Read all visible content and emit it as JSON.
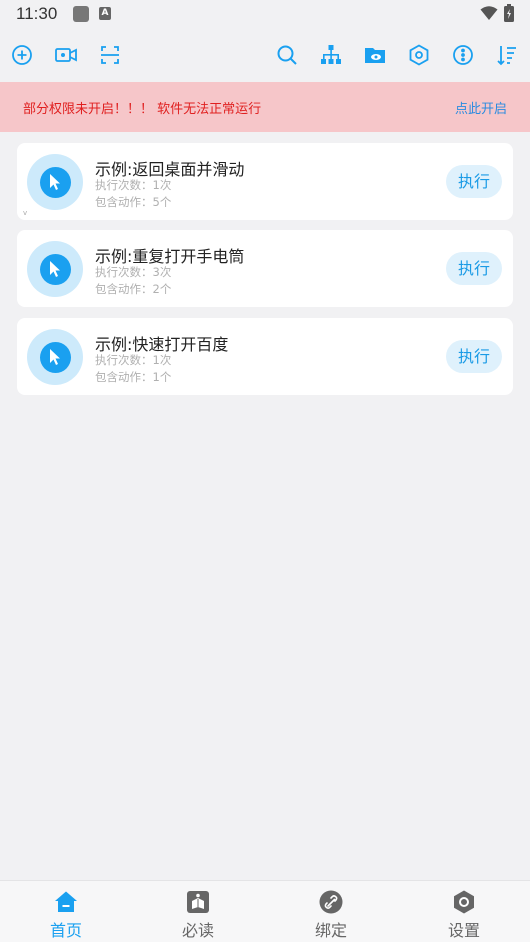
{
  "status_bar": {
    "time": "11:30"
  },
  "toolbar": {
    "left_icons": [
      "add-circle-icon",
      "video-record-icon",
      "scan-icon"
    ],
    "right_icons": [
      "search-icon",
      "hierarchy-icon",
      "folder-eye-icon",
      "hexagon-settings-icon",
      "info-more-icon",
      "sort-icon"
    ],
    "accent_color": "#1aa0f0"
  },
  "warning": {
    "message": "部分权限未开启！！！ 软件无法正常运行",
    "action_label": "点此开启",
    "text_color": "#e02020",
    "background_color": "#f6c6c9"
  },
  "tasks": [
    {
      "title": "示例:返回桌面并滑动",
      "exec_count": "执行次数：1次",
      "action_count": "包含动作：5个",
      "run_label": "执行",
      "marker": "v"
    },
    {
      "title": "示例:重复打开手电筒",
      "exec_count": "执行次数：3次",
      "action_count": "包含动作：2个",
      "run_label": "执行"
    },
    {
      "title": "示例:快速打开百度",
      "exec_count": "执行次数：1次",
      "action_count": "包含动作：1个",
      "run_label": "执行"
    }
  ],
  "bottom_nav": [
    {
      "label": "首页",
      "icon": "home-icon",
      "active": true
    },
    {
      "label": "必读",
      "icon": "book-icon",
      "active": false
    },
    {
      "label": "绑定",
      "icon": "link-icon",
      "active": false
    },
    {
      "label": "设置",
      "icon": "settings-icon",
      "active": false
    }
  ]
}
